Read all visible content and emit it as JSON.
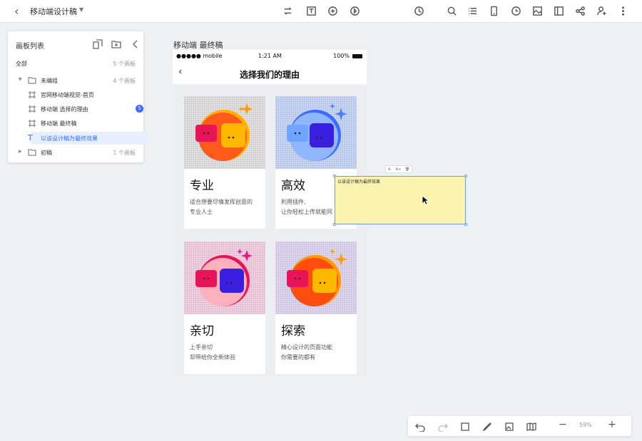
{
  "header": {
    "back_icon": "chevron-left-icon",
    "title": "移动端设计稿",
    "dropdown_icon": "caret-down-icon"
  },
  "sidebar": {
    "title": "画板列表",
    "all_label": "全部",
    "all_count": "5 个画板",
    "groups": [
      {
        "label": "未编组",
        "count": "4 个画板"
      },
      {
        "label": "初稿",
        "count": "1 个画板"
      }
    ],
    "items": [
      {
        "label": "官网移动端视觉-首页"
      },
      {
        "label": "移动端 选择的理由",
        "badge": "S"
      },
      {
        "label": "移动端 最终稿"
      },
      {
        "label": "以该设计稿为最终效果"
      }
    ]
  },
  "artboard": {
    "title": "移动端 最终稿",
    "status_left": "●●●●● mobile",
    "status_time": "1:21 AM",
    "status_battery": "100%",
    "nav_title": "选择我们的理由"
  },
  "cards": [
    {
      "heading": "专业",
      "desc1": "适合想要尽情发挥创意的",
      "desc2": "专业人士"
    },
    {
      "heading": "高效",
      "desc1": "利用插件,",
      "desc2": "让你轻松上传就能同"
    },
    {
      "heading": "亲切",
      "desc1": "上手亲切",
      "desc2": "却带给你全新体验"
    },
    {
      "heading": "探索",
      "desc1": "精心设计的页面功能",
      "desc2": "你需要的都有"
    }
  ],
  "note": {
    "text": "以该设计稿为最终效果",
    "tools": [
      "A-",
      "A+",
      "🗑"
    ]
  },
  "bottom": {
    "zoom": "59%",
    "minus": "−",
    "plus": "+"
  },
  "colors": {
    "accent": "#2f6bff",
    "note_bg": "#fbf3b0"
  }
}
